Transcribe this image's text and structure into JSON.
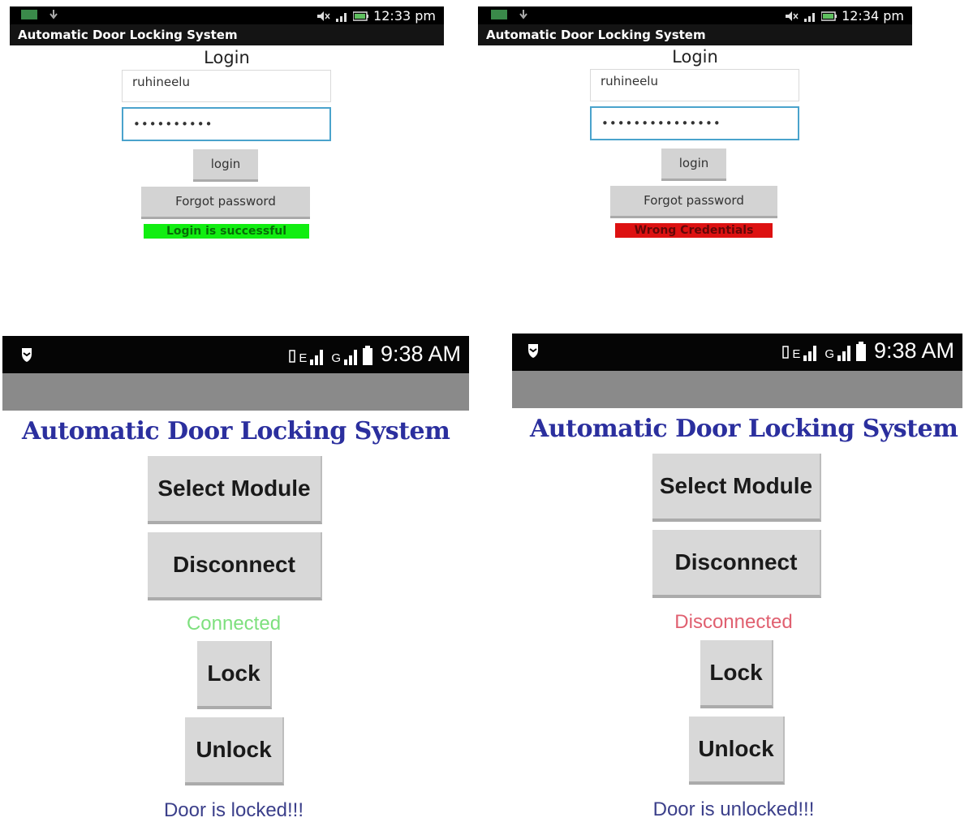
{
  "login_screens": [
    {
      "status_bar": {
        "time": "12:33 pm"
      },
      "app_title": "Automatic Door Locking System",
      "heading": "Login",
      "username": "ruhineelu",
      "password_mask": "••••••••••",
      "login_button": "login",
      "forgot_button": "Forgot password",
      "message": "Login is successful",
      "message_color": "#11ee11"
    },
    {
      "status_bar": {
        "time": "12:34 pm"
      },
      "app_title": "Automatic Door Locking System",
      "heading": "Login",
      "username": "ruhineelu",
      "password_mask": "•••••••••••••••",
      "login_button": "login",
      "forgot_button": "Forgot password",
      "message": "Wrong Credentials",
      "message_color": "#dd1111"
    }
  ],
  "control_screens": [
    {
      "status_bar": {
        "time": "9:38 AM",
        "network": "E",
        "network2": "G"
      },
      "title": "Automatic Door Locking System",
      "select_module_button": "Select Module",
      "disconnect_button": "Disconnect",
      "connection_status": "Connected",
      "connection_color": "#7ee07e",
      "lock_button": "Lock",
      "unlock_button": "Unlock",
      "door_status": "Door is locked!!!",
      "door_status_color": "#3b3f8a"
    },
    {
      "status_bar": {
        "time": "9:38 AM",
        "network": "E",
        "network2": "G"
      },
      "title": "Automatic Door Locking System",
      "select_module_button": "Select Module",
      "disconnect_button": "Disconnect",
      "connection_status": "Disconnected",
      "connection_color": "#e06070",
      "lock_button": "Lock",
      "unlock_button": "Unlock",
      "door_status": "Door is unlocked!!!",
      "door_status_color": "#3b3f8a"
    }
  ],
  "icons": [
    "image-icon",
    "download-icon",
    "mute-icon",
    "signal-icon",
    "battery-icon",
    "shield-icon",
    "vibrate-icon"
  ]
}
